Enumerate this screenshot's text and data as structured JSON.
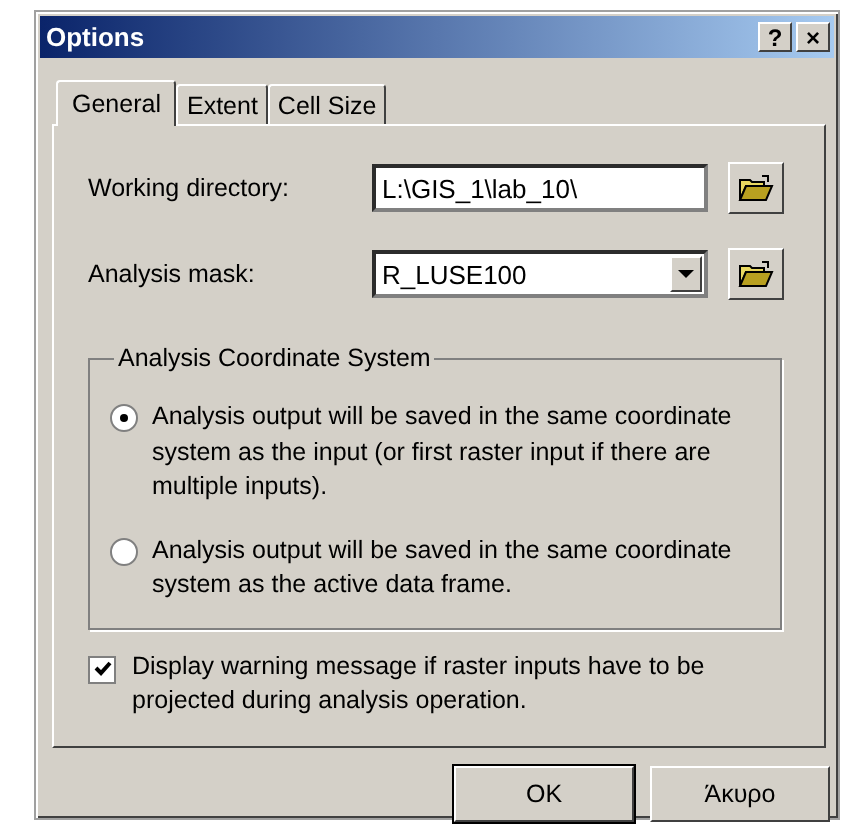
{
  "window": {
    "title": "Options",
    "help": "?",
    "close": "×"
  },
  "tabs": [
    {
      "label": "General",
      "selected": true
    },
    {
      "label": "Extent",
      "selected": false
    },
    {
      "label": "Cell Size",
      "selected": false
    }
  ],
  "working_directory": {
    "label": "Working directory:",
    "value": "L:\\GIS_1\\lab_10\\"
  },
  "analysis_mask": {
    "label": "Analysis mask:",
    "value": "R_LUSE100"
  },
  "coordinate_system": {
    "title": "Analysis Coordinate System",
    "options": [
      {
        "label": "Analysis output will be saved in the same coordinate system as the input (or first raster input if there are multiple inputs).",
        "selected": true
      },
      {
        "label": "Analysis output will be saved in the same coordinate system as the active data frame.",
        "selected": false
      }
    ]
  },
  "warning": {
    "label": "Display warning message if raster inputs have to be projected during analysis operation.",
    "checked": true
  },
  "buttons": [
    "OK",
    "Άκυρο"
  ]
}
